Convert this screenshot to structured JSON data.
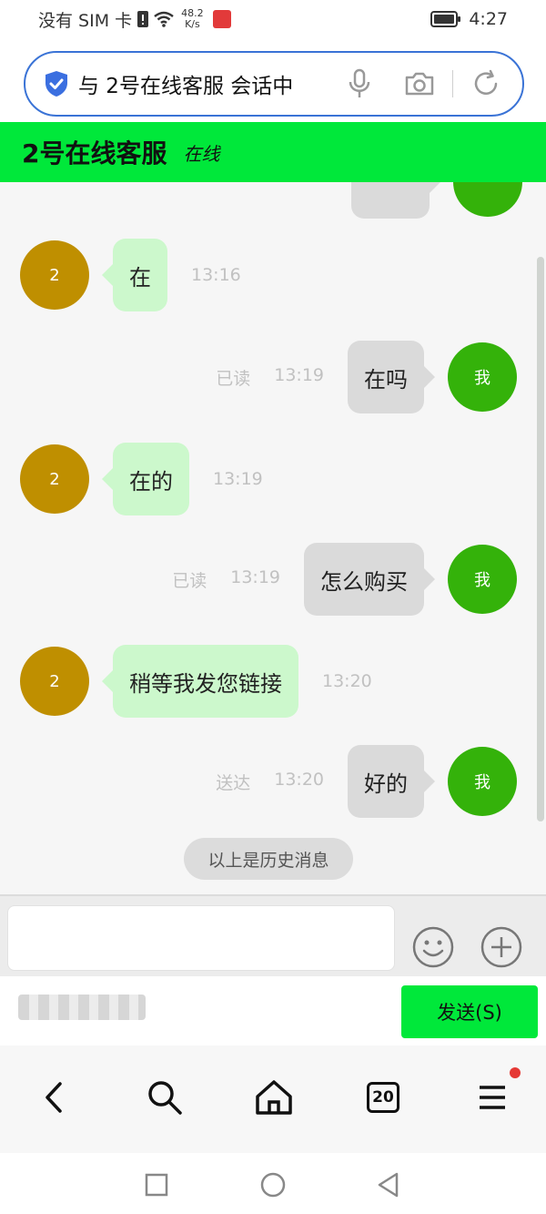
{
  "status_bar": {
    "carrier": "没有 SIM 卡",
    "speed_value": "48.2",
    "speed_unit": "K/s",
    "time": "4:27"
  },
  "address_bar": {
    "url_text": "与 2号在线客服 会话中",
    "icons": [
      "shield-icon",
      "mic-icon",
      "camera-icon",
      "refresh-icon"
    ]
  },
  "chat": {
    "title": "2号在线客服",
    "status": "在线"
  },
  "messages": [
    {
      "from": "other",
      "avatar": "2",
      "text": "在",
      "time": "13:16"
    },
    {
      "from": "me",
      "avatar": "我",
      "text": "在吗",
      "status": "已读",
      "time": "13:19"
    },
    {
      "from": "other",
      "avatar": "2",
      "text": "在的",
      "time": "13:19"
    },
    {
      "from": "me",
      "avatar": "我",
      "text": "怎么购买",
      "status": "已读",
      "time": "13:19"
    },
    {
      "from": "other",
      "avatar": "2",
      "text": "稍等我发您链接",
      "time": "13:20"
    },
    {
      "from": "me",
      "avatar": "我",
      "text": "好的",
      "status": "送达",
      "time": "13:20"
    }
  ],
  "history_divider": "以上是历史消息",
  "input": {
    "value": "",
    "send_label": "发送(S)"
  },
  "browser_nav": {
    "tab_count": "20",
    "icons": [
      "back-icon",
      "search-icon",
      "home-icon",
      "tabs-icon",
      "menu-icon"
    ]
  },
  "colors": {
    "header_green": "#00e83a",
    "other_bubble": "#ccf8cc",
    "me_bubble": "#dadada",
    "other_avatar": "#bf8f00",
    "me_avatar": "#34b20a"
  }
}
